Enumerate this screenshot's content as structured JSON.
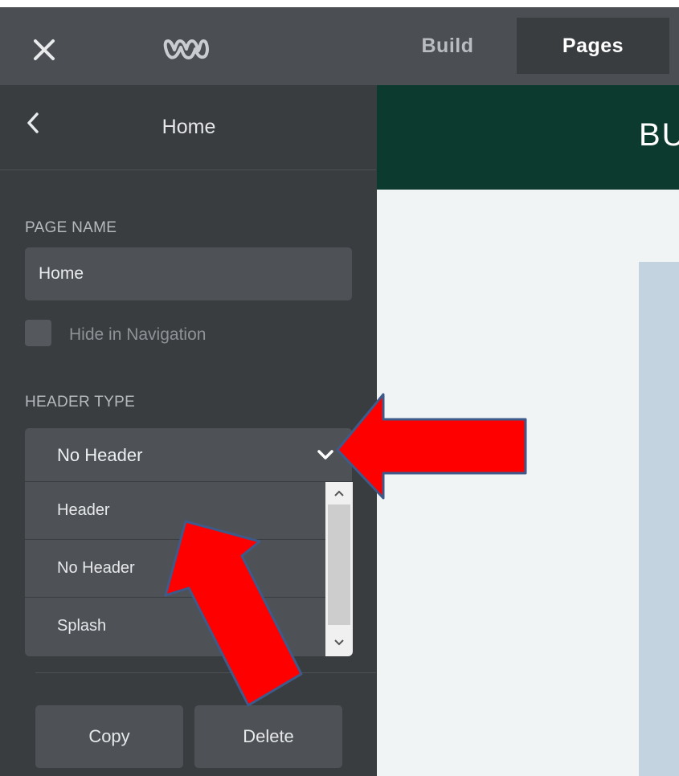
{
  "topbar": {
    "close_icon": "close-icon",
    "logo_icon": "weebly-w-logo",
    "tabs": [
      {
        "label": "Build",
        "active": false
      },
      {
        "label": "Pages",
        "active": true
      }
    ]
  },
  "sidebar": {
    "back_icon": "chevron-left-icon",
    "title": "Home",
    "page_name_label": "PAGE NAME",
    "page_name_value": "Home",
    "hide_nav_label": "Hide in Navigation",
    "hide_nav_checked": false,
    "header_type_label": "HEADER TYPE",
    "header_type_selected": "No Header",
    "header_type_options": [
      "Header",
      "No Header",
      "Splash"
    ],
    "copy_label": "Copy",
    "delete_label": "Delete"
  },
  "preview": {
    "title": "BU"
  },
  "colors": {
    "topbar": "#4b4f54",
    "sidebar": "#3a3d40",
    "control": "#4e5257",
    "preview_header": "#0d3a2e",
    "preview_body": "#f1f4f5",
    "annotation_arrow": "#ff0000",
    "annotation_outline": "#3d5a8a"
  }
}
